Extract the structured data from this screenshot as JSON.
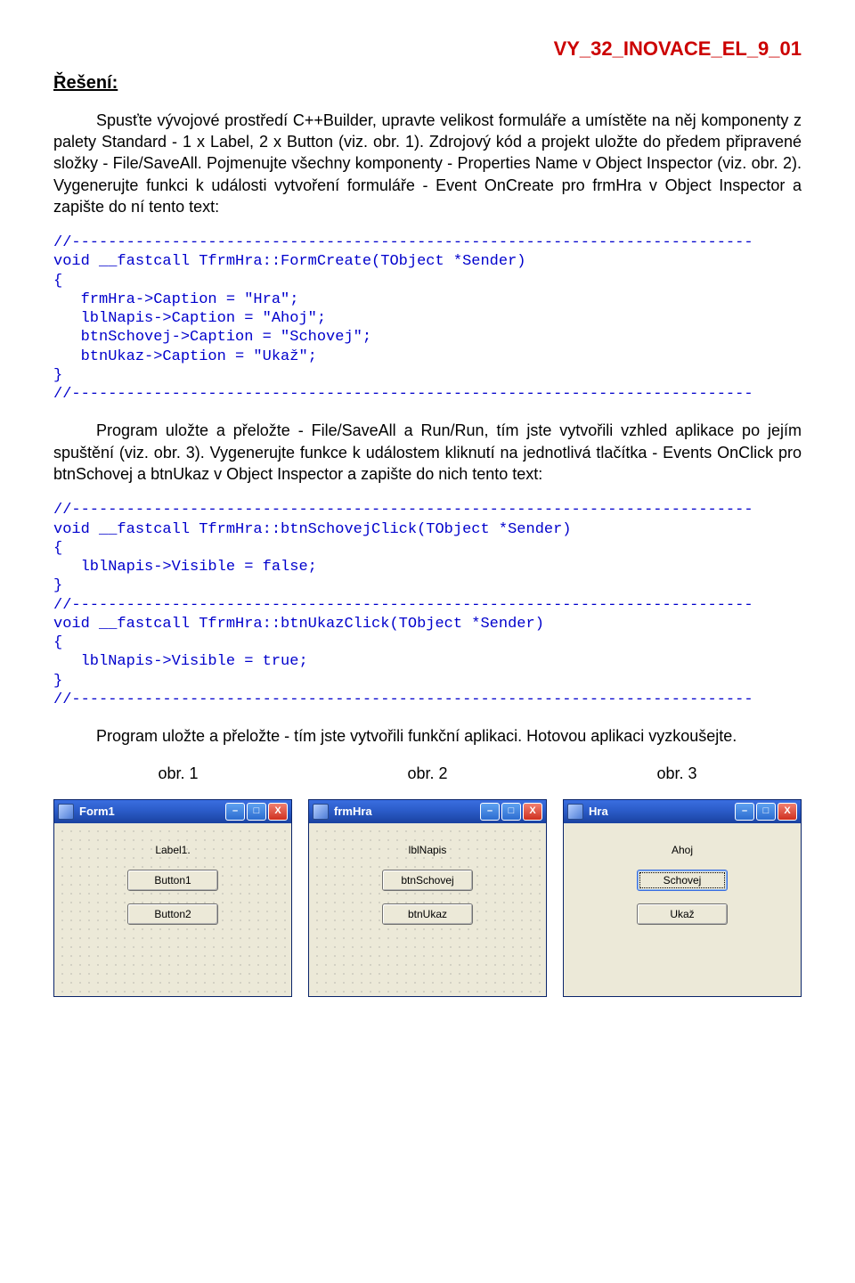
{
  "header_code": "VY_32_INOVACE_EL_9_01",
  "section_title": "Řešení:",
  "para1": "Spusťte vývojové prostředí C++Builder, upravte velikost formuláře a umístěte na něj komponenty z palety Standard - 1 x Label, 2 x Button (viz. obr. 1). Zdrojový kód a projekt uložte do předem připravené složky - File/SaveAll. Pojmenujte všechny komponenty - Properties Name v Object Inspector (viz. obr. 2). Vygenerujte funkci k události vytvoření formuláře - Event OnCreate pro frmHra v Object Inspector a zapište do ní tento text:",
  "code1": "//---------------------------------------------------------------------------\nvoid __fastcall TfrmHra::FormCreate(TObject *Sender)\n{\n   frmHra->Caption = \"Hra\";\n   lblNapis->Caption = \"Ahoj\";\n   btnSchovej->Caption = \"Schovej\";\n   btnUkaz->Caption = \"Ukaž\";\n}\n//---------------------------------------------------------------------------",
  "para2": "Program uložte a přeložte - File/SaveAll a Run/Run, tím jste vytvořili vzhled aplikace po jejím spuštění (viz. obr. 3). Vygenerujte funkce k událostem kliknutí na jednotlivá tlačítka - Events OnClick pro btnSchovej a btnUkaz v Object Inspector a zapište do nich tento text:",
  "code2": "//---------------------------------------------------------------------------\nvoid __fastcall TfrmHra::btnSchovejClick(TObject *Sender)\n{\n   lblNapis->Visible = false;\n}\n//---------------------------------------------------------------------------\nvoid __fastcall TfrmHra::btnUkazClick(TObject *Sender)\n{\n   lblNapis->Visible = true;\n}\n//---------------------------------------------------------------------------",
  "para3": "Program uložte a přeložte - tím jste vytvořili funkční aplikaci. Hotovou aplikaci vyzkoušejte.",
  "figs": {
    "labels": [
      "obr. 1",
      "obr. 2",
      "obr. 3"
    ],
    "win1": {
      "title": "Form1",
      "label": "Label1.",
      "btn1": "Button1",
      "btn2": "Button2"
    },
    "win2": {
      "title": "frmHra",
      "label": "lblNapis",
      "btn1": "btnSchovej",
      "btn2": "btnUkaz"
    },
    "win3": {
      "title": "Hra",
      "label": "Ahoj",
      "btn1": "Schovej",
      "btn2": "Ukaž"
    }
  },
  "winbtns": {
    "min": "–",
    "max": "□",
    "close": "X"
  }
}
